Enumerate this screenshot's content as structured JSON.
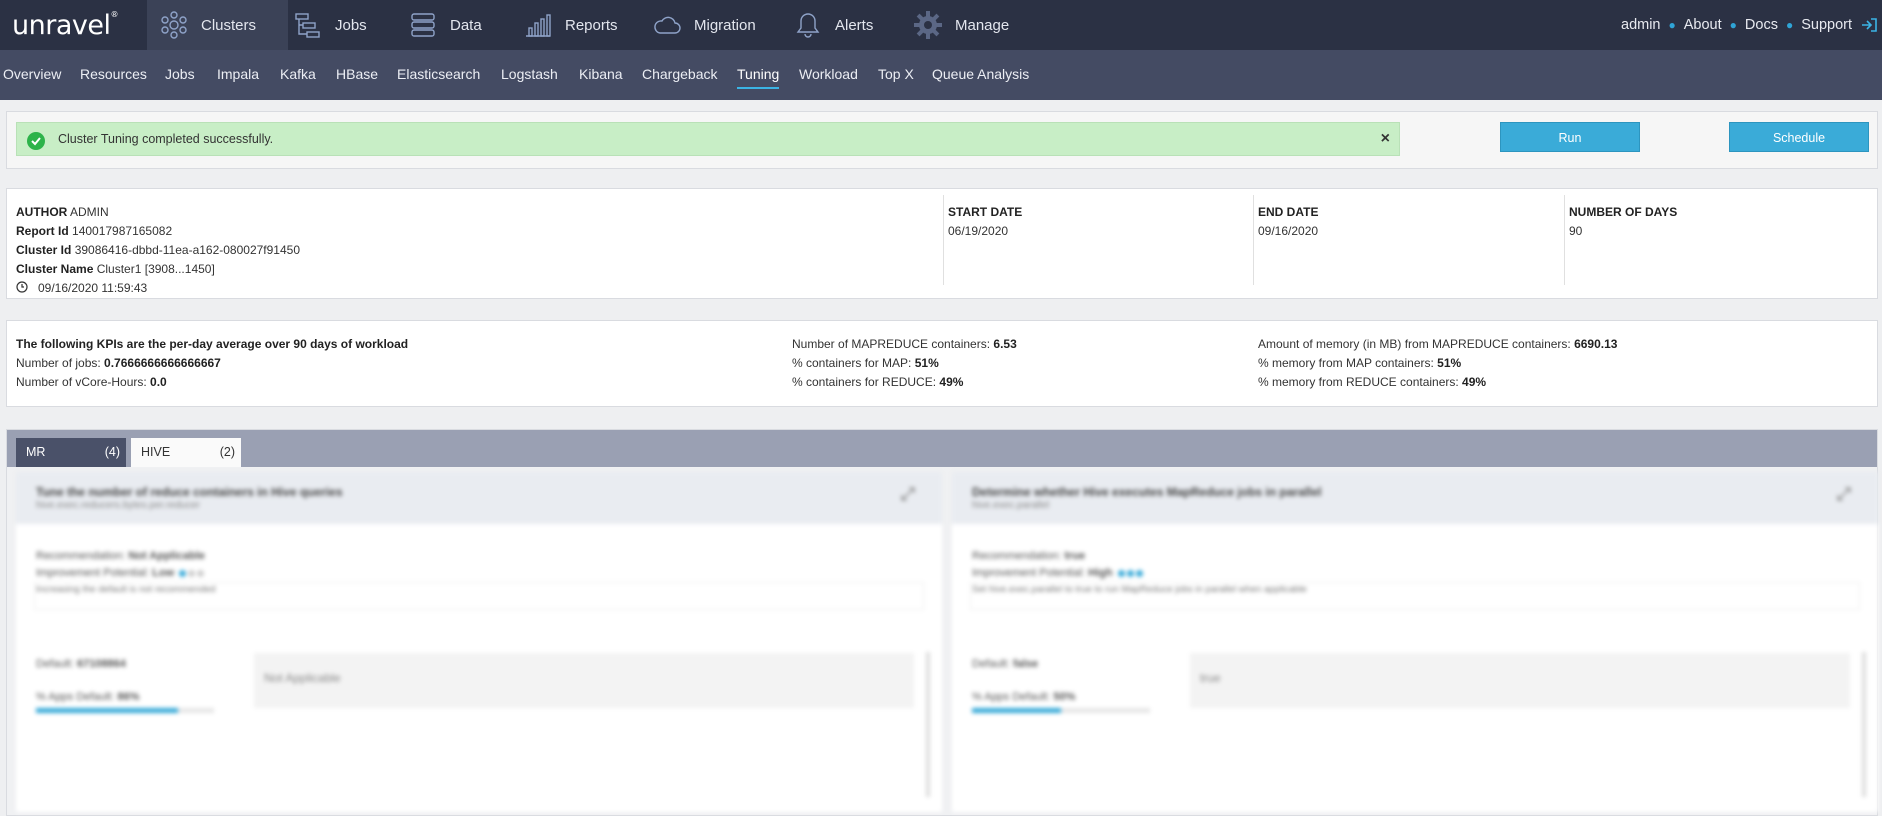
{
  "brand": {
    "logo_text": "unravel"
  },
  "nav": {
    "items": [
      {
        "label": "Clusters",
        "icon": "clusters-icon",
        "active": true
      },
      {
        "label": "Jobs",
        "icon": "jobs-icon",
        "active": false
      },
      {
        "label": "Data",
        "icon": "data-icon",
        "active": false
      },
      {
        "label": "Reports",
        "icon": "reports-icon",
        "active": false
      },
      {
        "label": "Migration",
        "icon": "cloud-icon",
        "active": false
      },
      {
        "label": "Alerts",
        "icon": "bell-icon",
        "active": false
      },
      {
        "label": "Manage",
        "icon": "gear-icon",
        "active": false
      }
    ],
    "right": {
      "user": "admin",
      "about": "About",
      "docs": "Docs",
      "support": "Support"
    }
  },
  "subnav": {
    "items": [
      "Overview",
      "Resources",
      "Jobs",
      "Impala",
      "Kafka",
      "HBase",
      "Elasticsearch",
      "Logstash",
      "Kibana",
      "Chargeback",
      "Tuning",
      "Workload",
      "Top X",
      "Queue Analysis"
    ],
    "active": "Tuning"
  },
  "alert": {
    "message": "Cluster Tuning completed successfully.",
    "close": "×"
  },
  "buttons": {
    "run": "Run",
    "schedule": "Schedule"
  },
  "info": {
    "author_label": "AUTHOR",
    "author": "ADMIN",
    "report_id_label": "Report Id",
    "report_id": "140017987165082",
    "cluster_id_label": "Cluster Id",
    "cluster_id": "39086416-dbbd-11ea-a162-080027f91450",
    "cluster_name_label": "Cluster Name",
    "cluster_name": "Cluster1 [3908...1450]",
    "timestamp": "09/16/2020 11:59:43",
    "start_date_label": "START DATE",
    "start_date": "06/19/2020",
    "end_date_label": "END DATE",
    "end_date": "09/16/2020",
    "days_label": "NUMBER OF DAYS",
    "days": "90"
  },
  "kpi": {
    "heading": "The following KPIs are the per-day average over 90 days of workload",
    "jobs_label": "Number of jobs: ",
    "jobs": "0.7666666666666667",
    "vcore_label": "Number of vCore-Hours: ",
    "vcore": "0.0",
    "mr_containers_label": "Number of MAPREDUCE containers: ",
    "mr_containers": "6.53",
    "map_containers_label": "% containers for MAP: ",
    "map_containers": "51%",
    "reduce_containers_label": "% containers for REDUCE: ",
    "reduce_containers": "49%",
    "memory_label": "Amount of memory (in MB) from MAPREDUCE containers: ",
    "memory": "6690.13",
    "map_memory_label": "% memory from MAP containers: ",
    "map_memory": "51%",
    "reduce_memory_label": "% memory from REDUCE containers: ",
    "reduce_memory": "49%"
  },
  "tabs": [
    {
      "label": "MR",
      "count": "(4)",
      "active": true
    },
    {
      "label": "HIVE",
      "count": "(2)",
      "active": false
    }
  ],
  "cards": [
    {
      "title": "Tune the number of reduce containers in Hive queries",
      "subtitle": "hive.exec.reducers.bytes.per.reducer",
      "recommendation_label": "Recommendation: ",
      "recommendation": "Not Applicable",
      "potential_label": "Improvement Potential: ",
      "potential": "Low",
      "description": "Increasing the default is not recommended",
      "default_label": "Default: ",
      "default": "67108864",
      "apps_label": "% Apps Default: ",
      "apps": "86%",
      "apps_fraction": 0.8,
      "value": "Not Applicable"
    },
    {
      "title": "Determine whether Hive executes MapReduce jobs in parallel",
      "subtitle": "hive.exec.parallel",
      "recommendation_label": "Recommendation: ",
      "recommendation": "true",
      "potential_label": "Improvement Potential: ",
      "potential": "High",
      "description": "Set hive.exec.parallel to true to run MapReduce jobs in parallel when applicable",
      "default_label": "Default: ",
      "default": "false",
      "apps_label": "% Apps Default: ",
      "apps": "50%",
      "apps_fraction": 0.5,
      "value": "true"
    }
  ],
  "colors": {
    "topbar": "#2b3144",
    "subnav": "#444b63",
    "accent": "#3aabd8",
    "success_bg": "#c8eec6"
  }
}
